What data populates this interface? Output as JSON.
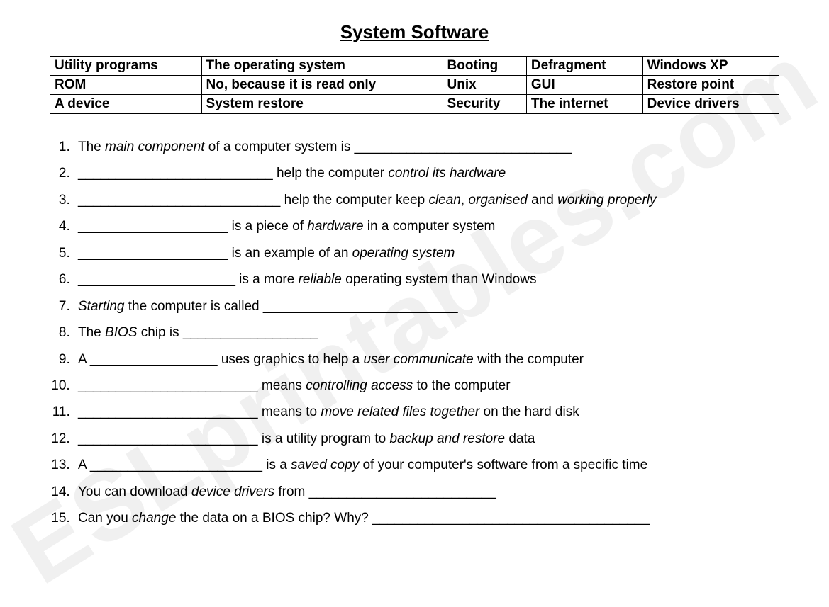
{
  "title": "System Software",
  "watermark": "ESLprintables.com",
  "wordbank": [
    [
      "Utility programs",
      "The operating system",
      "Booting",
      "Defragment",
      "Windows XP"
    ],
    [
      "ROM",
      "No, because it is read only",
      "Unix",
      "GUI",
      "Restore point"
    ],
    [
      "A device",
      "System restore",
      "Security",
      "The internet",
      "Device drivers"
    ]
  ],
  "questions": [
    {
      "segments": [
        {
          "text": "The "
        },
        {
          "text": "main component",
          "italic": true
        },
        {
          "text": " of a computer system is  _____________________________"
        }
      ]
    },
    {
      "segments": [
        {
          "text": "__________________________ help the computer "
        },
        {
          "text": "control its hardware",
          "italic": true
        }
      ]
    },
    {
      "segments": [
        {
          "text": "___________________________ help the computer keep "
        },
        {
          "text": "clean",
          "italic": true
        },
        {
          "text": ", "
        },
        {
          "text": "organised",
          "italic": true
        },
        {
          "text": " and "
        },
        {
          "text": "working properly",
          "italic": true
        }
      ]
    },
    {
      "segments": [
        {
          "text": "____________________ is a piece of "
        },
        {
          "text": "hardware",
          "italic": true
        },
        {
          "text": " in a computer system"
        }
      ]
    },
    {
      "segments": [
        {
          "text": "____________________ is an example of an "
        },
        {
          "text": "operating system",
          "italic": true
        }
      ]
    },
    {
      "segments": [
        {
          "text": "_____________________ is a more "
        },
        {
          "text": "reliable",
          "italic": true
        },
        {
          "text": " operating system than Windows"
        }
      ]
    },
    {
      "segments": [
        {
          "text": "Starting",
          "italic": true
        },
        {
          "text": " the computer is called __________________________"
        }
      ]
    },
    {
      "segments": [
        {
          "text": "The "
        },
        {
          "text": "BIOS",
          "italic": true
        },
        {
          "text": " chip is __________________"
        }
      ]
    },
    {
      "segments": [
        {
          "text": "A _________________ uses graphics to help a "
        },
        {
          "text": "user communicate",
          "italic": true
        },
        {
          "text": " with the computer"
        }
      ]
    },
    {
      "segments": [
        {
          "text": "________________________ means "
        },
        {
          "text": "controlling access",
          "italic": true
        },
        {
          "text": " to the computer"
        }
      ]
    },
    {
      "segments": [
        {
          "text": "________________________ means to "
        },
        {
          "text": "move related files together",
          "italic": true
        },
        {
          "text": " on the hard disk"
        }
      ]
    },
    {
      "segments": [
        {
          "text": "________________________ is a utility program to "
        },
        {
          "text": "backup and restore",
          "italic": true
        },
        {
          "text": " data"
        }
      ]
    },
    {
      "segments": [
        {
          "text": "A _______________________ is a "
        },
        {
          "text": "saved copy",
          "italic": true
        },
        {
          "text": " of your computer's software from a specific time"
        }
      ]
    },
    {
      "segments": [
        {
          "text": "You can download "
        },
        {
          "text": "device drivers",
          "italic": true
        },
        {
          "text": " from _________________________"
        }
      ]
    },
    {
      "segments": [
        {
          "text": "Can you "
        },
        {
          "text": "change",
          "italic": true
        },
        {
          "text": " the data on a BIOS chip? Why? _____________________________________"
        }
      ]
    }
  ]
}
